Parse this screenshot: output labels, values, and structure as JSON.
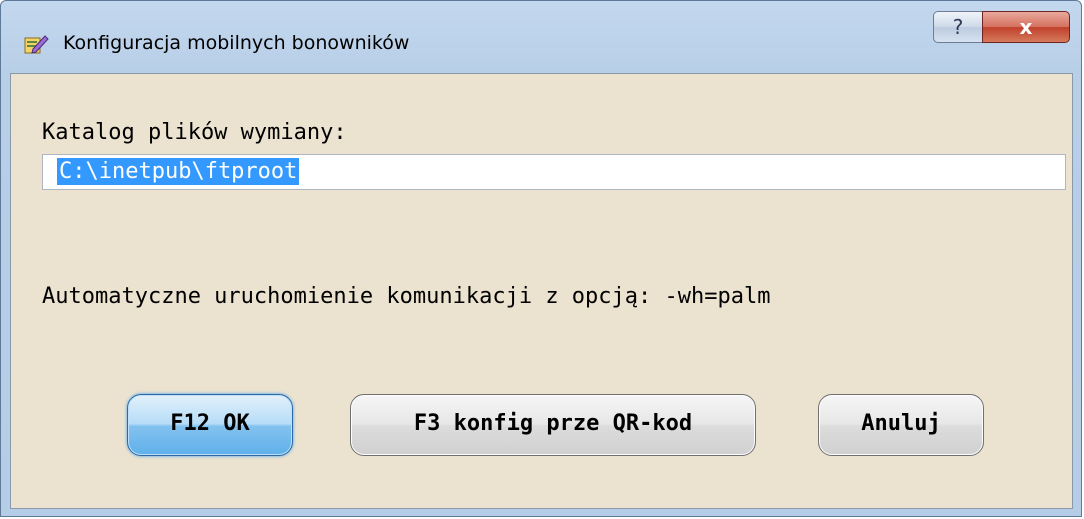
{
  "window": {
    "title": "Konfiguracja mobilnych bonowników",
    "icon": "edit-icon",
    "help_label": "?",
    "close_label": "x"
  },
  "form": {
    "folder_label": "Katalog plików wymiany:",
    "folder_value": "C:\\inetpub\\ftproot",
    "auto_label": "Automatyczne uruchomienie komunikacji z opcją: -wh=palm"
  },
  "buttons": {
    "ok": "F12 OK",
    "qr": "F3 konfig prze QR-kod",
    "cancel": "Anuluj"
  },
  "colors": {
    "client_bg": "#ebe2d0",
    "selection": "#3399ff",
    "primary_button": "#83c2ef"
  }
}
